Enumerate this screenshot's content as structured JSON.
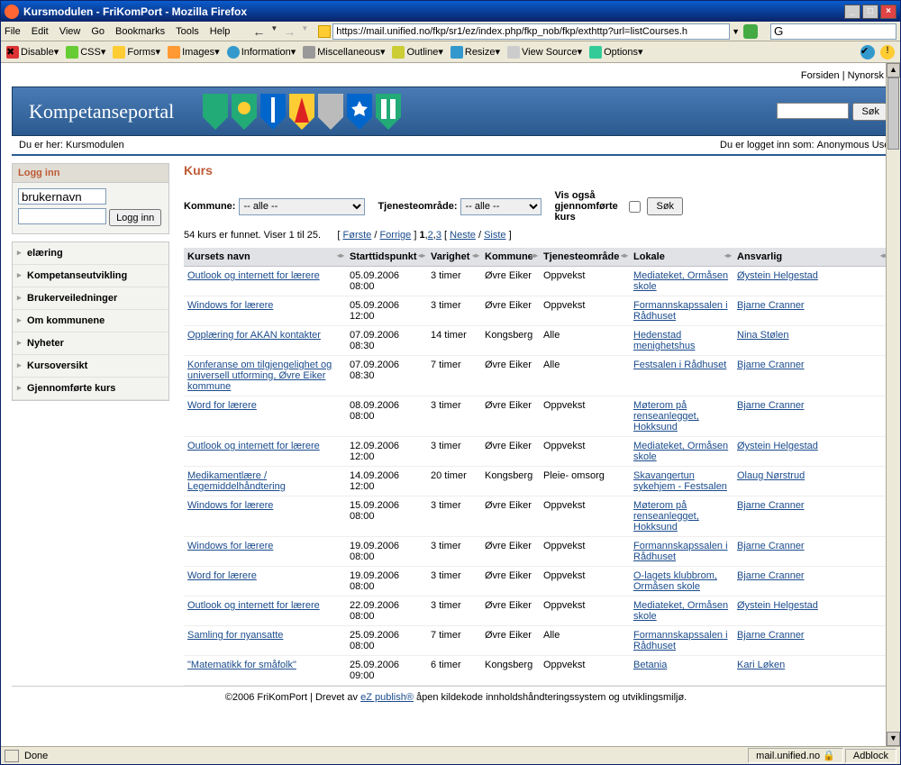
{
  "window": {
    "title": "Kursmodulen - FriKomPort - Mozilla Firefox"
  },
  "menu": {
    "file": "File",
    "edit": "Edit",
    "view": "View",
    "go": "Go",
    "bookmarks": "Bookmarks",
    "tools": "Tools",
    "help": "Help"
  },
  "url": "https://mail.unified.no/fkp/sr1/ez/index.php/fkp_nob/fkp/exthttp?url=listCourses.h",
  "devbar": {
    "disable": "Disable",
    "css": "CSS",
    "forms": "Forms",
    "images": "Images",
    "information": "Information",
    "miscellaneous": "Miscellaneous",
    "outline": "Outline",
    "resize": "Resize",
    "viewsource": "View Source",
    "options": "Options"
  },
  "toplinks": {
    "forsiden": "Forsiden",
    "nynorsk": "Nynorsk"
  },
  "header": {
    "title": "Kompetanseportal",
    "search_btn": "Søk"
  },
  "breadcrumb": {
    "prefix": "Du er her:",
    "current": "Kursmodulen",
    "login_prefix": "Du er logget inn som:",
    "user": "Anonymous User"
  },
  "login": {
    "title": "Logg inn",
    "user_value": "brukernavn",
    "btn": "Logg inn"
  },
  "nav": [
    "elæring",
    "Kompetanseutvikling",
    "Brukerveiledninger",
    "Om kommunene",
    "Nyheter",
    "Kursoversikt",
    "Gjennomførte kurs"
  ],
  "page": {
    "title": "Kurs"
  },
  "filter": {
    "kommune_lbl": "Kommune:",
    "kommune_sel": "-- alle --",
    "tjeneste_lbl": "Tjenesteområde:",
    "tjeneste_sel": "-- alle --",
    "vis": "Vis også gjennomførte kurs",
    "btn": "Søk"
  },
  "results": {
    "count": "54 kurs er funnet. Viser 1 til 25.",
    "first": "Første",
    "prev": "Forrige",
    "p1": "1",
    "p2": "2",
    "p3": "3",
    "next": "Neste",
    "last": "Siste"
  },
  "cols": {
    "name": "Kursets navn",
    "start": "Starttidspunkt",
    "dur": "Varighet",
    "kom": "Kommune",
    "tjen": "Tjenesteområde",
    "lok": "Lokale",
    "ans": "Ansvarlig"
  },
  "rows": [
    {
      "name": "Outlook og internett for lærere",
      "start": "05.09.2006 08:00",
      "dur": "3 timer",
      "kom": "Øvre Eiker",
      "tjen": "Oppvekst",
      "lok": "Mediateket, Ormåsen skole",
      "ans": "Øystein Helgestad"
    },
    {
      "name": "Windows for lærere",
      "start": "05.09.2006 12:00",
      "dur": "3 timer",
      "kom": "Øvre Eiker",
      "tjen": "Oppvekst",
      "lok": "Formannskapssalen i Rådhuset",
      "ans": "Bjarne Cranner"
    },
    {
      "name": "Opplæring for AKAN kontakter",
      "start": "07.09.2006 08:30",
      "dur": "14 timer",
      "kom": "Kongsberg",
      "tjen": "Alle",
      "lok": "Hedenstad menighetshus",
      "ans": "Nina Stølen"
    },
    {
      "name": "Konferanse om tilgjengelighet og universell utforming, Øvre Eiker kommune",
      "start": "07.09.2006 08:30",
      "dur": "7 timer",
      "kom": "Øvre Eiker",
      "tjen": "Alle",
      "lok": "Festsalen i Rådhuset",
      "ans": "Bjarne Cranner"
    },
    {
      "name": "Word for lærere",
      "start": "08.09.2006 08:00",
      "dur": "3 timer",
      "kom": "Øvre Eiker",
      "tjen": "Oppvekst",
      "lok": "Møterom på renseanlegget, Hokksund",
      "ans": "Bjarne Cranner"
    },
    {
      "name": "Outlook og internett for lærere",
      "start": "12.09.2006 12:00",
      "dur": "3 timer",
      "kom": "Øvre Eiker",
      "tjen": "Oppvekst",
      "lok": "Mediateket, Ormåsen skole",
      "ans": "Øystein Helgestad"
    },
    {
      "name": "Medikamentlære / Legemiddelhåndtering",
      "start": "14.09.2006 12:00",
      "dur": "20 timer",
      "kom": "Kongsberg",
      "tjen": "Pleie- omsorg",
      "lok": "Skavangertun sykehjem - Festsalen",
      "ans": "Olaug Nørstrud"
    },
    {
      "name": "Windows for lærere",
      "start": "15.09.2006 08:00",
      "dur": "3 timer",
      "kom": "Øvre Eiker",
      "tjen": "Oppvekst",
      "lok": "Møterom på renseanlegget, Hokksund",
      "ans": "Bjarne Cranner"
    },
    {
      "name": "Windows for lærere",
      "start": "19.09.2006 08:00",
      "dur": "3 timer",
      "kom": "Øvre Eiker",
      "tjen": "Oppvekst",
      "lok": "Formannskapssalen i Rådhuset",
      "ans": "Bjarne Cranner"
    },
    {
      "name": "Word for lærere",
      "start": "19.09.2006 08:00",
      "dur": "3 timer",
      "kom": "Øvre Eiker",
      "tjen": "Oppvekst",
      "lok": "O-lagets klubbrom, Ormåsen skole",
      "ans": "Bjarne Cranner"
    },
    {
      "name": "Outlook og internett for lærere",
      "start": "22.09.2006 08:00",
      "dur": "3 timer",
      "kom": "Øvre Eiker",
      "tjen": "Oppvekst",
      "lok": "Mediateket, Ormåsen skole",
      "ans": "Øystein Helgestad"
    },
    {
      "name": "Samling for nyansatte",
      "start": "25.09.2006 08:00",
      "dur": "7 timer",
      "kom": "Øvre Eiker",
      "tjen": "Alle",
      "lok": "Formannskapssalen i Rådhuset",
      "ans": "Bjarne Cranner"
    },
    {
      "name": "\"Matematikk for småfolk\"",
      "start": "25.09.2006 09:00",
      "dur": "6 timer",
      "kom": "Kongsberg",
      "tjen": "Oppvekst",
      "lok": "Betania",
      "ans": "Kari Løken"
    }
  ],
  "footer": {
    "copy": "©2006 FriKomPort | Drevet av ",
    "link": "eZ publish®",
    "rest": " åpen kildekode innholdshåndteringssystem og utviklingsmiljø."
  },
  "status": {
    "done": "Done",
    "host": "mail.unified.no",
    "adblock": "Adblock"
  }
}
